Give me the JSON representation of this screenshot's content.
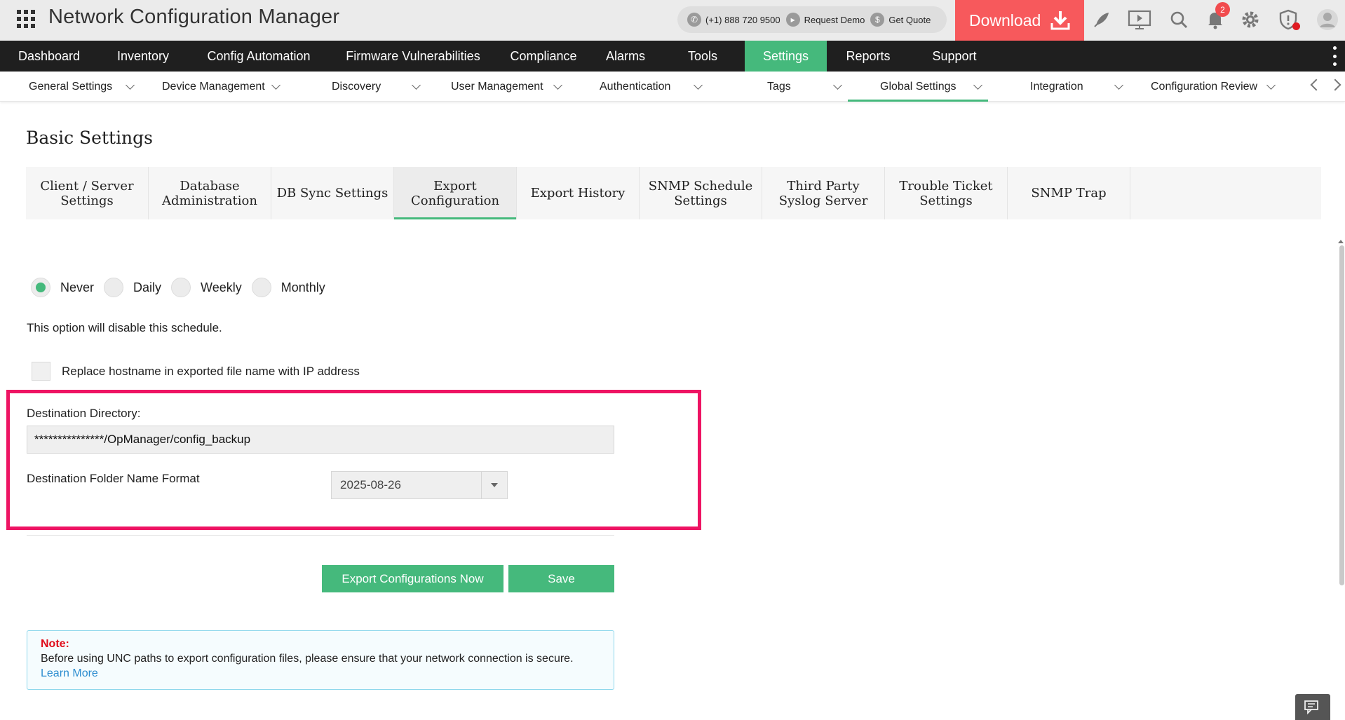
{
  "app": {
    "title": "Network Configuration Manager"
  },
  "topbar": {
    "phone": "(+1) 888 720 9500",
    "request_demo": "Request Demo",
    "get_quote": "Get Quote",
    "download_label": "Download",
    "notification_count": "2",
    "accent": "#f7595c"
  },
  "mainnav": {
    "items": [
      {
        "label": "Dashboard"
      },
      {
        "label": "Inventory"
      },
      {
        "label": "Config Automation"
      },
      {
        "label": "Firmware Vulnerabilities"
      },
      {
        "label": "Compliance"
      },
      {
        "label": "Alarms"
      },
      {
        "label": "Tools"
      },
      {
        "label": "Settings"
      },
      {
        "label": "Reports"
      },
      {
        "label": "Support"
      }
    ],
    "active": "Settings",
    "active_color": "#45b97c"
  },
  "subnav": {
    "items": [
      {
        "label": "General Settings"
      },
      {
        "label": "Device Management"
      },
      {
        "label": "Discovery"
      },
      {
        "label": "User Management"
      },
      {
        "label": "Authentication"
      },
      {
        "label": "Tags"
      },
      {
        "label": "Global Settings"
      },
      {
        "label": "Integration"
      },
      {
        "label": "Configuration Review"
      }
    ],
    "active": "Global Settings"
  },
  "page": {
    "title": "Basic Settings"
  },
  "tabs": {
    "items": [
      {
        "label": "Client / Server Settings"
      },
      {
        "label": "Database Administration"
      },
      {
        "label": "DB Sync Settings"
      },
      {
        "label": "Export Configuration"
      },
      {
        "label": "Export History"
      },
      {
        "label": "SNMP Schedule Settings"
      },
      {
        "label": "Third Party Syslog Server"
      },
      {
        "label": "Trouble Ticket Settings"
      },
      {
        "label": "SNMP Trap"
      }
    ],
    "active": "Export Configuration"
  },
  "schedule": {
    "options": [
      {
        "label": "Never"
      },
      {
        "label": "Daily"
      },
      {
        "label": "Weekly"
      },
      {
        "label": "Monthly"
      }
    ],
    "selected": "Never",
    "note": "This option will disable this schedule."
  },
  "form": {
    "replace_hostname_label": "Replace hostname in exported file name with IP address",
    "replace_hostname_checked": false,
    "destination_directory_label": "Destination Directory:",
    "destination_directory_value": "***************/OpManager/config_backup",
    "folder_format_label": "Destination Folder Name Format",
    "folder_format_value": "2025-08-26",
    "highlight_color": "#ee1463"
  },
  "buttons": {
    "export_now": "Export Configurations Now",
    "save": "Save"
  },
  "note": {
    "title": "Note:",
    "text": "Before using UNC paths to export configuration files, please ensure that your network connection is secure.",
    "link": "Learn More"
  }
}
